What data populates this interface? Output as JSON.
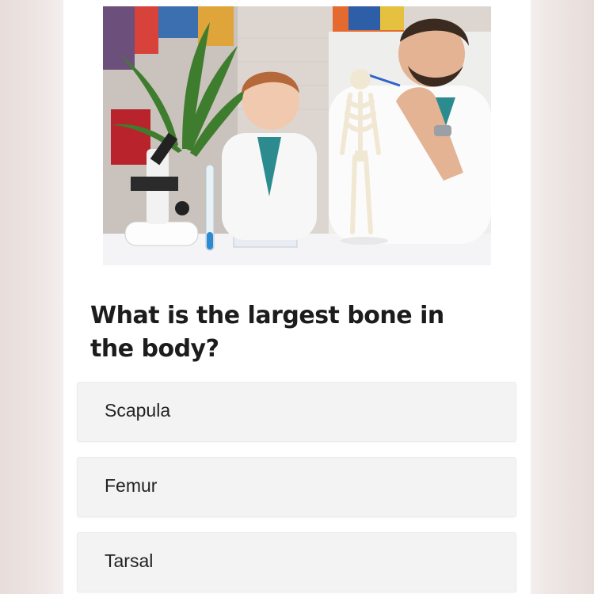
{
  "question": {
    "text": "What is the largest bone in the body?"
  },
  "image": {
    "icon": "classroom-photo"
  },
  "options": [
    {
      "label": "Scapula"
    },
    {
      "label": "Femur"
    },
    {
      "label": "Tarsal"
    }
  ]
}
